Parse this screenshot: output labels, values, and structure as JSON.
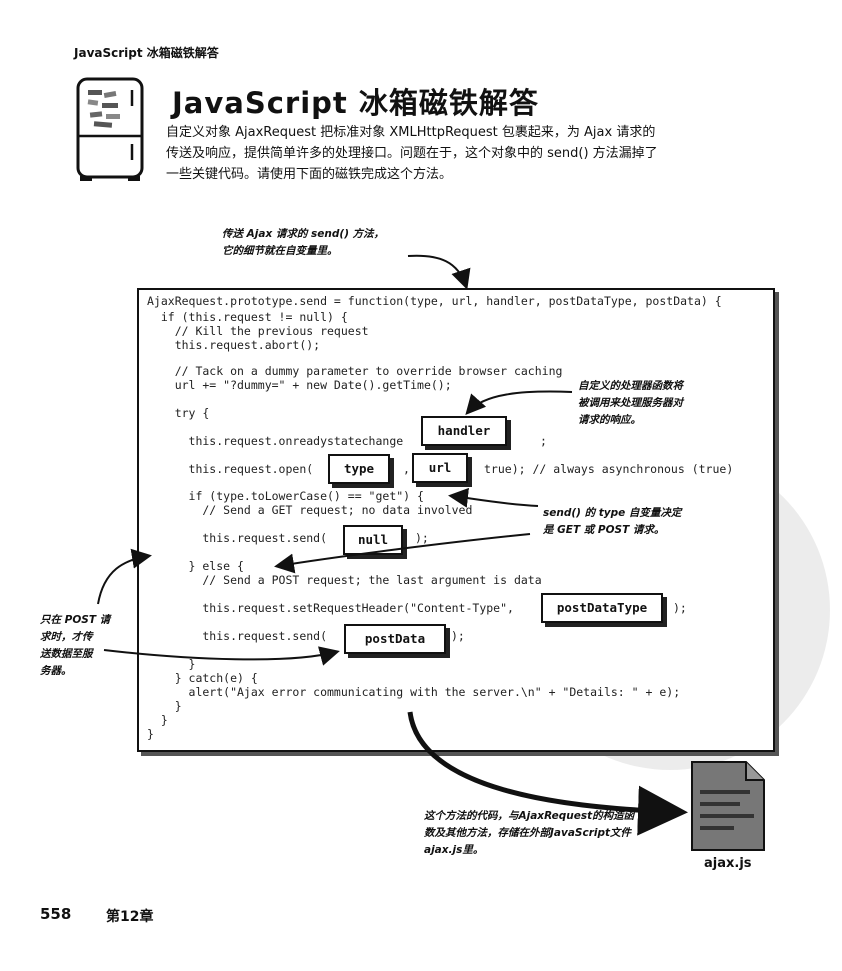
{
  "header": {
    "running_title": "JavaScript 冰箱磁铁解答"
  },
  "title": "JavaScript 冰箱磁铁解答",
  "intro": {
    "line1": "自定义对象 AjaxRequest 把标准对象 XMLHttpRequest 包裹起来，为 Ajax 请求的",
    "line2": "传送及响应，提供简单许多的处理接口。问题在于，这个对象中的 send() 方法漏掉了",
    "line3": "一些关键代码。请使用下面的磁铁完成这个方法。"
  },
  "code": {
    "l01": "AjaxRequest.prototype.send = function(type, url, handler, postDataType, postData) {",
    "l02": "  if (this.request != null) {",
    "l03": "    // Kill the previous request",
    "l04": "    this.request.abort();",
    "l05": "    // Tack on a dummy parameter to override browser caching",
    "l06": "    url += \"?dummy=\" + new Date().getTime();",
    "l07": "    try {",
    "l08": "      this.request.onreadystatechange",
    "l08b": ";",
    "l09": "      this.request.open(",
    "l09b": ",",
    "l09c": "true); // always asynchronous (true)",
    "l10": "      if (type.toLowerCase() == \"get\") {",
    "l11": "        // Send a GET request; no data involved",
    "l12": "        this.request.send(",
    "l12b": ");",
    "l13": "      } else {",
    "l14": "        // Send a POST request; the last argument is data",
    "l15": "        this.request.setRequestHeader(\"Content-Type\",",
    "l15b": ");",
    "l16": "        this.request.send(",
    "l16b": ");",
    "l17": "      }",
    "l18": "    } catch(e) {",
    "l19": "      alert(\"Ajax error communicating with the server.\\n\" + \"Details: \" + e);",
    "l20": "    }",
    "l21": "  }",
    "l22": "}"
  },
  "magnets": {
    "handler": "handler",
    "type": "type",
    "url": "url",
    "null": "null",
    "postDataType": "postDataType",
    "postData": "postData"
  },
  "notes": {
    "top_1": "传送 Ajax 请求的 send() 方法，",
    "top_2": "它的细节就在自变量里。",
    "handler_1": "自定义的处理器函数将",
    "handler_2": "被调用来处理服务器对",
    "handler_3": "请求的响应。",
    "type_1": "send() 的 type 自变量决定",
    "type_2": "是 GET 或 POST 请求。",
    "post_1": "只在 POST 请",
    "post_2": "求时，才传",
    "post_3": "送数据至服",
    "post_4": "务器。",
    "file_1": "这个方法的代码，与AjaxRequest的构造函",
    "file_2": "数及其他方法，存储在外部JavaScript文件",
    "file_3": "ajax.js里。"
  },
  "file_icon_label": "ajax.js",
  "footer": {
    "page_number": "558",
    "chapter": "第12章"
  }
}
